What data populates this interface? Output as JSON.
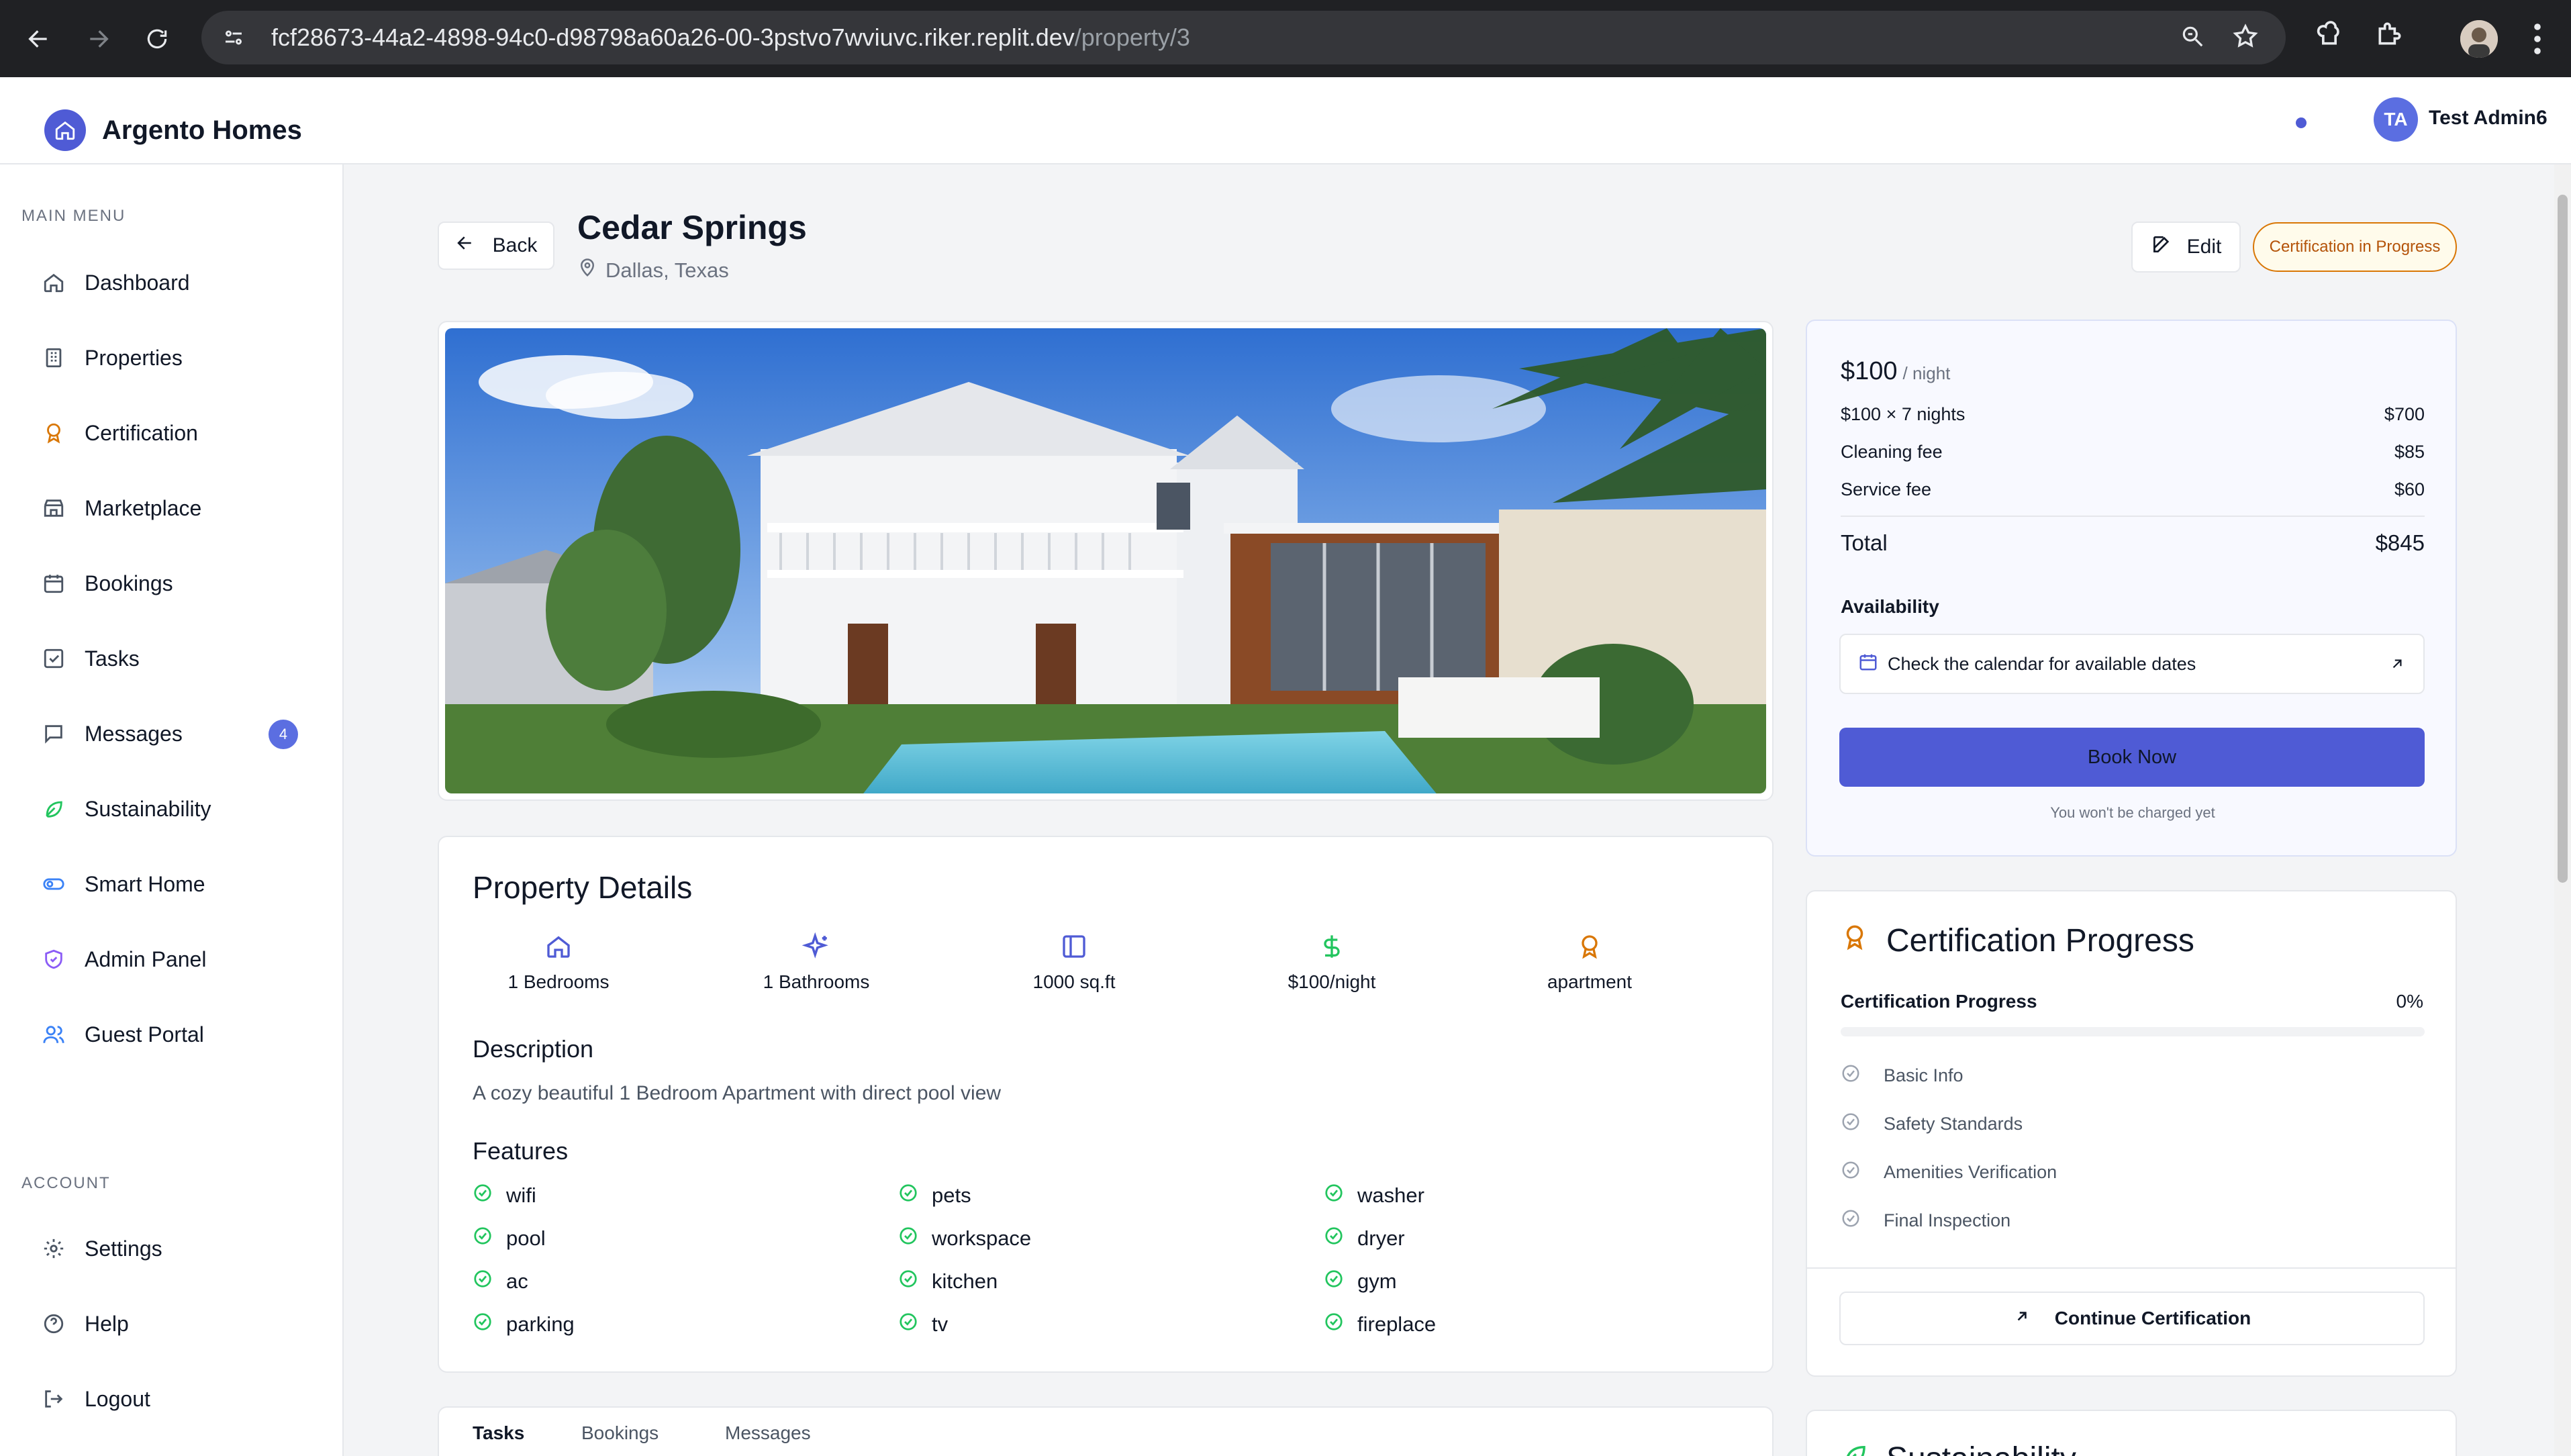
{
  "browser": {
    "url_host": "fcf28673-44a2-4898-94c0-d98798a60a26-00-3pstvo7wviuvc.riker.replit.dev",
    "url_path": "/property/3"
  },
  "app": {
    "brand": "Argento Homes",
    "user_initials": "TA",
    "user_name": "Test Admin6"
  },
  "sidebar": {
    "main_menu_label": "MAIN MENU",
    "account_label": "ACCOUNT",
    "items": [
      {
        "label": "Dashboard",
        "icon": "home-icon"
      },
      {
        "label": "Properties",
        "icon": "building-icon"
      },
      {
        "label": "Certification",
        "icon": "award-icon"
      },
      {
        "label": "Marketplace",
        "icon": "store-icon"
      },
      {
        "label": "Bookings",
        "icon": "calendar-icon"
      },
      {
        "label": "Tasks",
        "icon": "checkbox-icon"
      },
      {
        "label": "Messages",
        "icon": "message-icon",
        "badge": "4"
      },
      {
        "label": "Sustainability",
        "icon": "leaf-icon"
      },
      {
        "label": "Smart Home",
        "icon": "toggle-icon"
      },
      {
        "label": "Admin Panel",
        "icon": "shield-icon"
      },
      {
        "label": "Guest Portal",
        "icon": "users-icon"
      }
    ],
    "account_items": [
      {
        "label": "Settings",
        "icon": "gear-icon"
      },
      {
        "label": "Help",
        "icon": "help-icon"
      },
      {
        "label": "Logout",
        "icon": "logout-icon"
      }
    ]
  },
  "property": {
    "back_label": "Back",
    "title": "Cedar Springs",
    "location": "Dallas, Texas",
    "edit_label": "Edit",
    "status_badge": "Certification in Progress"
  },
  "details": {
    "heading": "Property Details",
    "stats": [
      {
        "value": "1 Bedrooms",
        "icon": "home-icon"
      },
      {
        "value": "1 Bathrooms",
        "icon": "sparkles-icon"
      },
      {
        "value": "1000 sq.ft",
        "icon": "layout-icon"
      },
      {
        "value": "$100/night",
        "icon": "dollar-icon"
      },
      {
        "value": "apartment",
        "icon": "award-icon"
      }
    ],
    "description_heading": "Description",
    "description": "A cozy beautiful 1 Bedroom Apartment with direct pool view",
    "features_heading": "Features",
    "features": [
      "wifi",
      "pool",
      "ac",
      "parking",
      "pets",
      "workspace",
      "kitchen",
      "tv",
      "washer",
      "dryer",
      "gym",
      "fireplace"
    ]
  },
  "tabs": [
    "Tasks",
    "Bookings",
    "Messages"
  ],
  "pricing": {
    "price": "$100",
    "unit": "/ night",
    "rows": [
      {
        "label": "$100 × 7 nights",
        "value": "$700"
      },
      {
        "label": "Cleaning fee",
        "value": "$85"
      },
      {
        "label": "Service fee",
        "value": "$60"
      }
    ],
    "total_label": "Total",
    "total_value": "$845",
    "availability_label": "Availability",
    "availability_text": "Check the calendar for available dates",
    "book_label": "Book Now",
    "charge_note": "You won't be charged yet"
  },
  "certification": {
    "title": "Certification Progress",
    "progress_label": "Certification Progress",
    "progress_text": "0%",
    "progress_fraction": 0,
    "steps": [
      "Basic Info",
      "Safety Standards",
      "Amenities Verification",
      "Final Inspection"
    ],
    "continue_label": "Continue Certification"
  },
  "sustainability": {
    "title": "Sustainability"
  },
  "colors": {
    "accent": "#4f5bd5",
    "award": "#d97706",
    "success": "#22c55e"
  }
}
